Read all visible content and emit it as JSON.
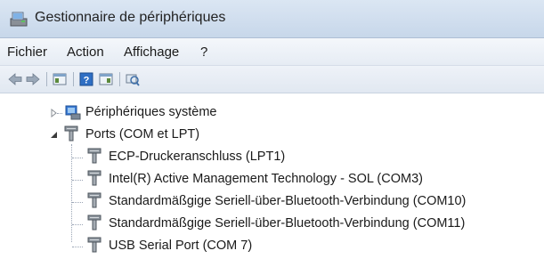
{
  "window": {
    "title": "Gestionnaire de périphériques"
  },
  "menu": {
    "items": [
      "Fichier",
      "Action",
      "Affichage",
      "?"
    ]
  },
  "toolbar": {
    "icons": [
      "back-icon",
      "forward-icon",
      "properties-icon",
      "help-icon",
      "view-icon",
      "scan-hardware-icon"
    ]
  },
  "tree": {
    "system_devices": "Périphériques système",
    "ports": "Ports (COM et LPT)",
    "children": [
      "ECP-Druckeranschluss (LPT1)",
      "Intel(R) Active Management Technology - SOL (COM3)",
      "Standardmäßgige Seriell-über-Bluetooth-Verbindung (COM10)",
      "Standardmäßgige Seriell-über-Bluetooth-Verbindung (COM11)",
      "USB Serial Port (COM 7)"
    ]
  }
}
